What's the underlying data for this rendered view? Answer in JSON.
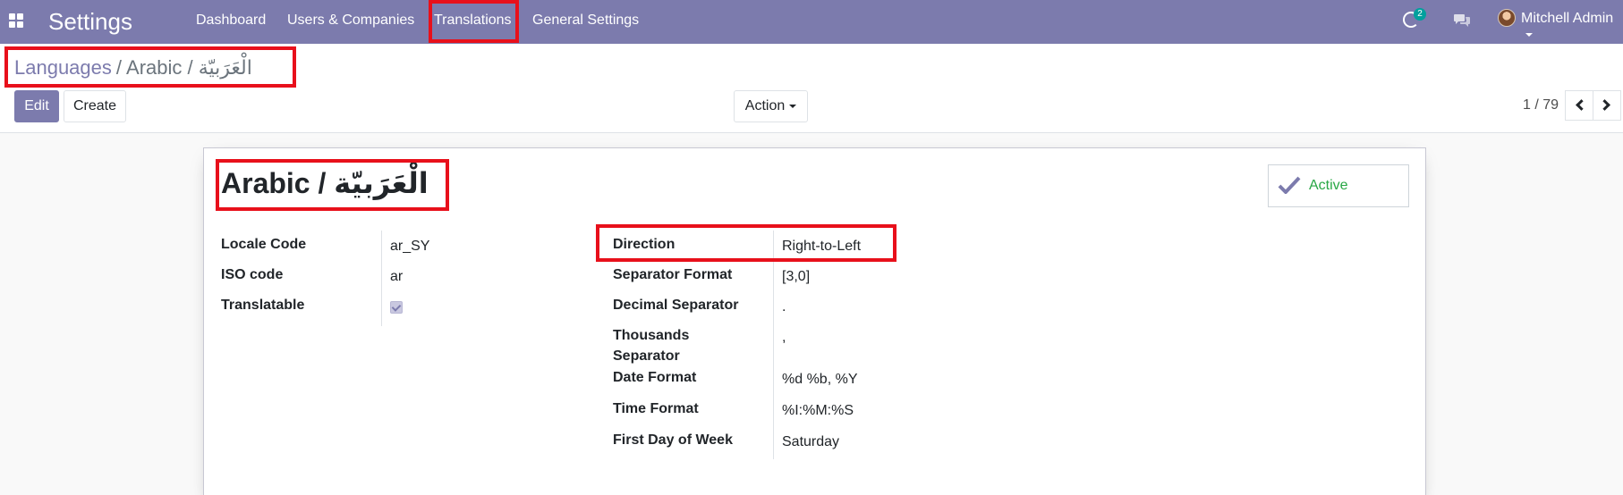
{
  "navbar": {
    "app_title": "Settings",
    "menu": [
      "Dashboard",
      "Users & Companies",
      "Translations",
      "General Settings"
    ],
    "activity_count": "2",
    "user_name": "Mitchell Admin",
    "icons": [
      "apps-grid-icon",
      "activity-clock-icon",
      "chat-icon",
      "avatar"
    ]
  },
  "breadcrumb": {
    "parent": "Languages",
    "separator": "/",
    "current": "Arabic / الْعَرَبيّة"
  },
  "toolbar": {
    "edit_label": "Edit",
    "create_label": "Create",
    "action_label": "Action"
  },
  "pager": {
    "value": "1 / 79"
  },
  "record": {
    "title": "Arabic / الْعَرَبيّة",
    "active_label": "Active",
    "left_fields": [
      {
        "label": "Locale Code",
        "value": "ar_SY"
      },
      {
        "label": "ISO code",
        "value": "ar"
      },
      {
        "label": "Translatable",
        "checked": true
      }
    ],
    "right_fields": [
      {
        "label": "Direction",
        "value": "Right-to-Left"
      },
      {
        "label": "Separator Format",
        "value": "[3,0]"
      },
      {
        "label": "Decimal Separator",
        "value": "."
      },
      {
        "label": "Thousands Separator",
        "value": ","
      },
      {
        "label": "Date Format",
        "value": "%d %b, %Y"
      },
      {
        "label": "Time Format",
        "value": "%I:%M:%S"
      },
      {
        "label": "First Day of Week",
        "value": "Saturday"
      }
    ]
  },
  "colors": {
    "brand": "#7c7bad",
    "highlight": "#e8101b",
    "active": "#28a745",
    "badge": "#00a09d"
  }
}
